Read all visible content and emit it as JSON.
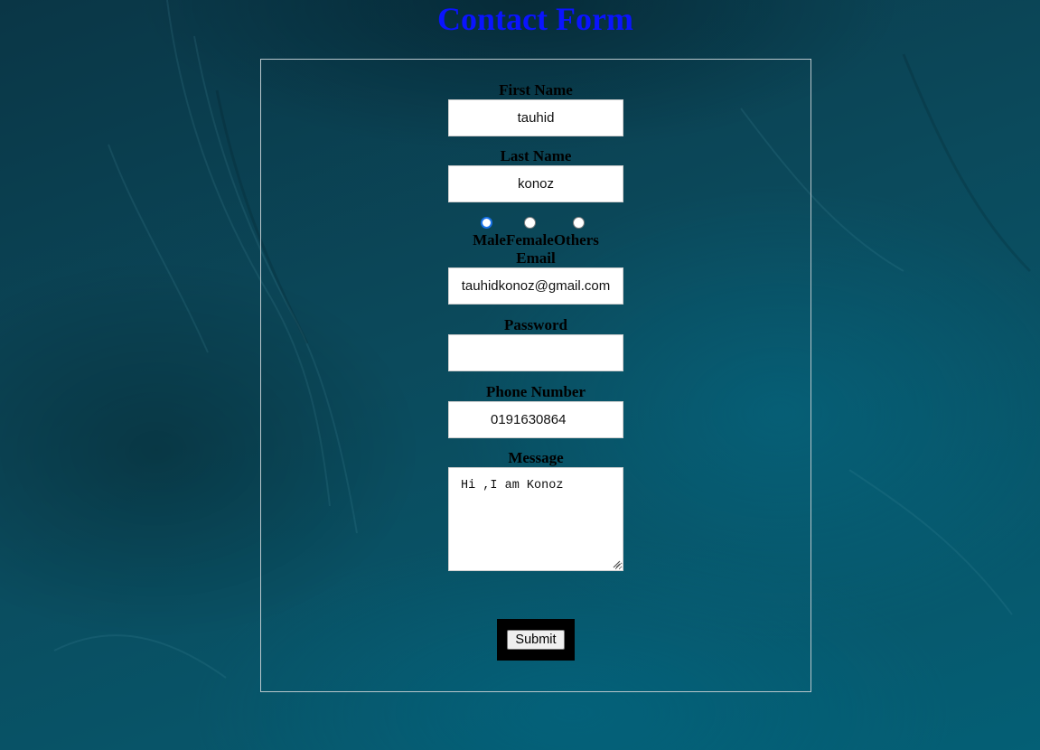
{
  "page": {
    "title": "Contact Form"
  },
  "form": {
    "first_name": {
      "label": "First Name",
      "value": "tauhid"
    },
    "last_name": {
      "label": "Last Name",
      "value": "konoz"
    },
    "gender": {
      "options": [
        {
          "label": "Male",
          "checked": true
        },
        {
          "label": "Female",
          "checked": false
        },
        {
          "label": "Others",
          "checked": false
        }
      ],
      "labels_text": "MaleFemaleOthers"
    },
    "email": {
      "label": "Email",
      "value": "tauhidkonoz@gmail.com"
    },
    "password": {
      "label": "Password",
      "value": ""
    },
    "phone": {
      "label": "Phone Number",
      "value": "0191630864"
    },
    "message": {
      "label": "Message",
      "value": "Hi ,I am Konoz"
    },
    "submit_label": "Submit"
  },
  "colors": {
    "title": "#0a14ff",
    "background": "#07404f",
    "radio_accent": "#1a73e8"
  }
}
